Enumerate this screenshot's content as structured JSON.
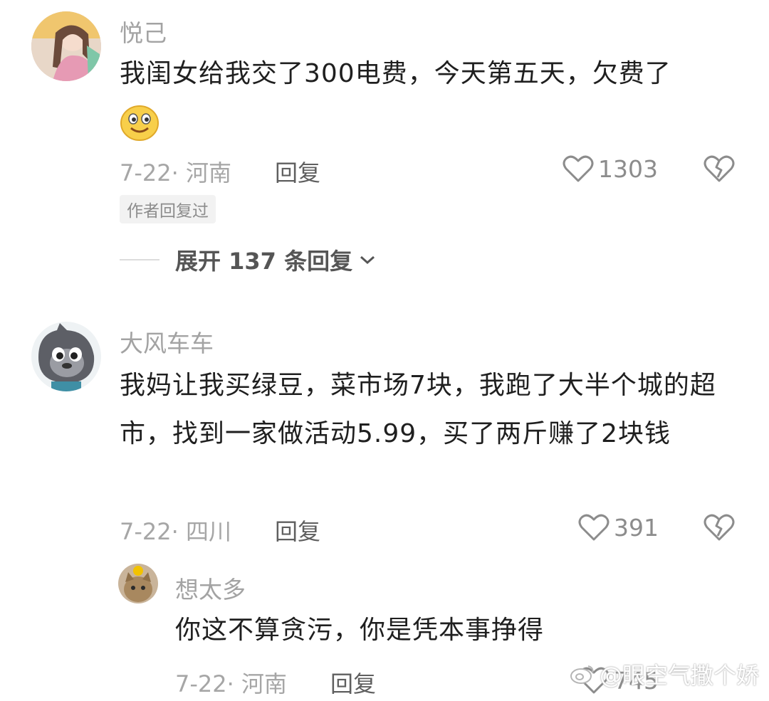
{
  "comments": [
    {
      "username": "悦己",
      "text": "我闺女给我交了300电费，今天第五天，欠费了",
      "date_location": "7-22· 河南",
      "reply_label": "回复",
      "likes": "1303",
      "author_badge": "作者回复过",
      "expand_label": "展开 137 条回复",
      "emoji": "smiley-emoji"
    },
    {
      "username": "大风车车",
      "text": "我妈让我买绿豆，菜市场7块，我跑了大半个城的超市，找到一家做活动5.99，买了两斤赚了2块钱",
      "date_location": "7-22· 四川",
      "reply_label": "回复",
      "likes": "391",
      "replies": [
        {
          "username": "想太多",
          "text": "你这不算贪污，你是凭本事挣得",
          "date_location": "7-22· 河南",
          "reply_label": "回复",
          "likes": "745"
        }
      ]
    }
  ],
  "watermark": {
    "text": "@眼空气撒个娇",
    "icon": "weibo-logo-icon"
  },
  "icons": {
    "like": "heart-outline-icon",
    "dislike": "broken-heart-icon",
    "expand": "chevron-down-icon"
  },
  "colors": {
    "text": "#1f1f1f",
    "muted": "#a6a6a6",
    "reply": "#5f5f5f"
  }
}
